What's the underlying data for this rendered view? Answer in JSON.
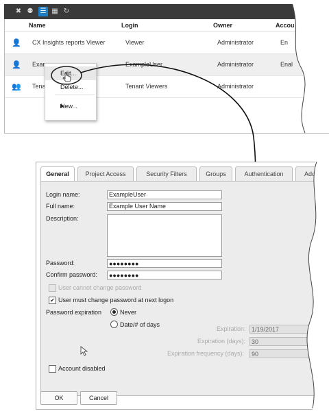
{
  "toolbar": {
    "icons": [
      "remove-user-icon",
      "add-user-icon",
      "list-view-icon",
      "grid-view-icon",
      "refresh-icon"
    ]
  },
  "list": {
    "columns": [
      "Name",
      "Login",
      "Owner",
      "Accou"
    ],
    "rows": [
      {
        "name": "CX Insights reports Viewer",
        "login": "Viewer",
        "owner": "Administrator",
        "extra": "En"
      },
      {
        "name": "Exar",
        "login": "ExampleUser",
        "owner": "Administrator",
        "extra": "Enal"
      },
      {
        "name": "Tena",
        "login": "Tenant Viewers",
        "owner": "Administrator",
        "extra": ""
      }
    ]
  },
  "context_menu": {
    "edit": "Edit...",
    "delete": "Delete...",
    "new": "New..."
  },
  "dialog": {
    "tabs": [
      "General",
      "Project Access",
      "Security Filters",
      "Groups",
      "Authentication",
      "Add"
    ],
    "login_name_label": "Login name:",
    "login_name_value": "ExampleUser",
    "full_name_label": "Full name:",
    "full_name_value": "Example User Name",
    "description_label": "Description:",
    "password_label": "Password:",
    "password_value": "●●●●●●●●",
    "confirm_label": "Confirm password:",
    "confirm_value": "●●●●●●●●",
    "cannot_change_label": "User cannot change password",
    "must_change_label": "User must change password at next logon",
    "expiration_label": "Password expiration",
    "never_label": "Never",
    "date_days_label": "Date/# of days",
    "expiration_field_label": "Expiration:",
    "expiration_value": "1/19/2017",
    "exp_days_label": "Expiration (days):",
    "exp_days_value": "30",
    "exp_freq_label": "Expiration frequency (days):",
    "exp_freq_value": "90",
    "account_disabled_label": "Account disabled",
    "ok": "OK",
    "cancel": "Cancel"
  }
}
